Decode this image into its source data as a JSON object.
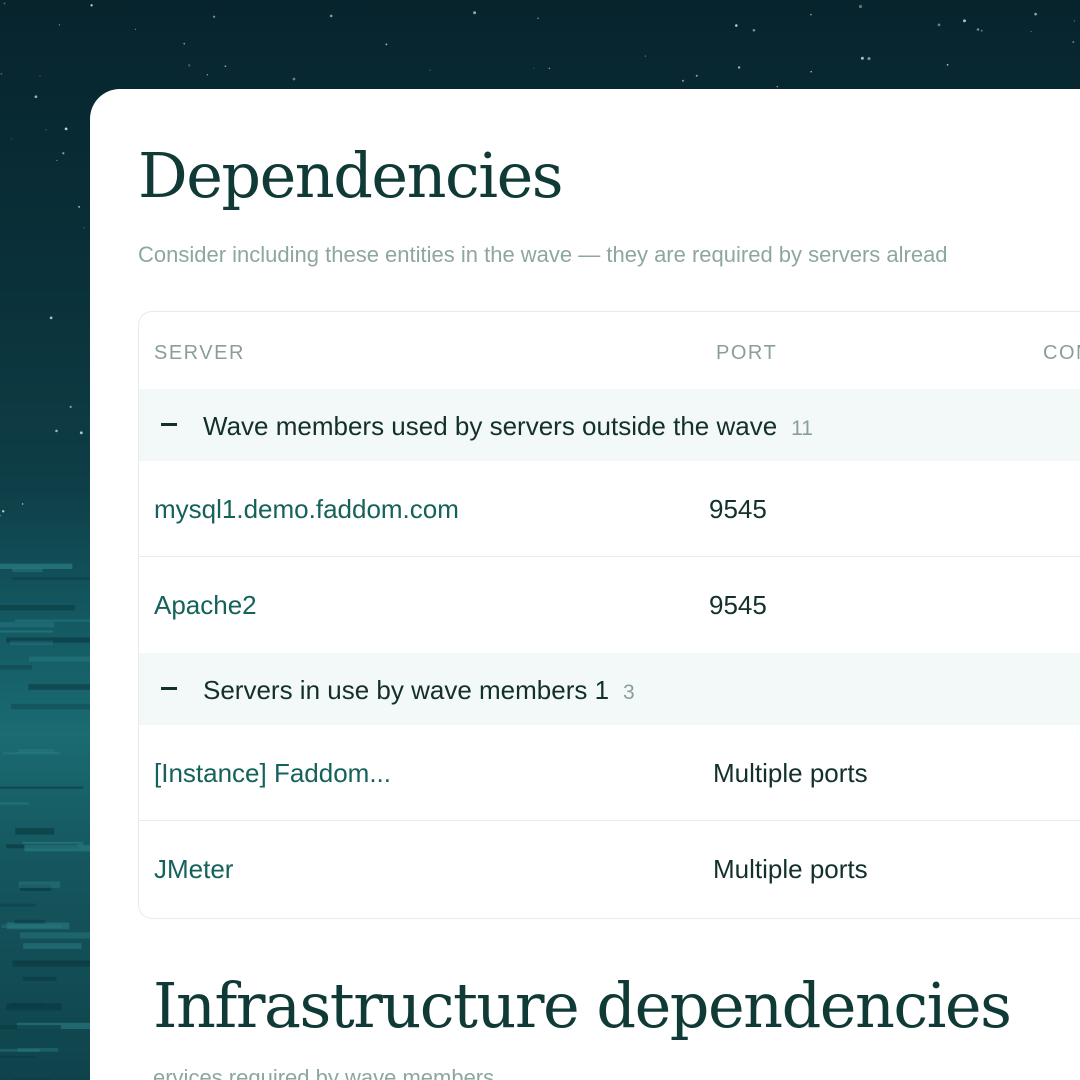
{
  "page": {
    "title": "Dependencies",
    "subtitle": "Consider including these entities in the wave — they are required by servers alread"
  },
  "table": {
    "columns": [
      "SERVER",
      "PORT",
      "CON"
    ],
    "groups": [
      {
        "label": "Wave members used by servers outside the wave",
        "count": "11",
        "rows": [
          {
            "server": "mysql1.demo.faddom.com",
            "port": "9545"
          },
          {
            "server": "Apache2",
            "port": "9545"
          }
        ]
      },
      {
        "label": "Servers in use by wave members 1",
        "count": "3",
        "rows": [
          {
            "server": "[Instance] Faddom...",
            "port": "Multiple ports"
          },
          {
            "server": "JMeter",
            "port": "Multiple ports"
          }
        ]
      }
    ]
  },
  "infrastructure": {
    "title": "Infrastructure dependencies",
    "subtitle": "ervices required by wave members"
  },
  "colors": {
    "title": "#0f3a35",
    "link": "#15625c",
    "muted": "#8a9e9a",
    "group_bg": "#f3f9f8",
    "border": "#e6ecea"
  }
}
